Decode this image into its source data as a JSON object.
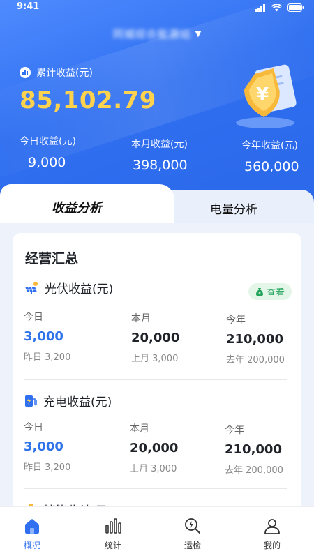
{
  "status_bar": {
    "time": "9:41"
  },
  "header": {
    "station_name": "同城综合能源站",
    "dropdown_icon": "caret-down-icon"
  },
  "summary": {
    "total_label": "累计收益(元)",
    "total_value": "85,102.79",
    "today_label": "今日收益(元)",
    "today_value": "9,000",
    "month_label": "本月收益(元)",
    "month_value": "398,000",
    "year_label": "今年收益(元)",
    "year_value": "560,000"
  },
  "tabs": [
    {
      "label": "收益分析",
      "active": true
    },
    {
      "label": "电量分析",
      "active": false
    }
  ],
  "section": {
    "title": "经营汇总",
    "view_label": "查看",
    "categories": [
      {
        "title": "光伏收益(元)",
        "icon": "solar-panel-icon",
        "columns": [
          {
            "label": "今日",
            "value": "3,000",
            "sub": "昨日 3,200"
          },
          {
            "label": "本月",
            "value": "20,000",
            "sub": "上月 3,000"
          },
          {
            "label": "今年",
            "value": "210,000",
            "sub": "去年 200,000"
          }
        ]
      },
      {
        "title": "充电收益(元)",
        "icon": "charging-pile-icon",
        "columns": [
          {
            "label": "今日",
            "value": "3,000",
            "sub": "昨日 3,200"
          },
          {
            "label": "本月",
            "value": "20,000",
            "sub": "上月 3,000"
          },
          {
            "label": "今年",
            "value": "210,000",
            "sub": "去年 200,000"
          }
        ]
      },
      {
        "title": "储能收益(元)",
        "icon": "storage-icon"
      }
    ]
  },
  "bottom_nav": [
    {
      "label": "概况",
      "icon": "home-icon",
      "active": true
    },
    {
      "label": "统计",
      "icon": "bar-chart-icon",
      "active": false
    },
    {
      "label": "运检",
      "icon": "inspect-icon",
      "active": false
    },
    {
      "label": "我的",
      "icon": "user-icon",
      "active": false
    }
  ],
  "colors": {
    "primary": "#2f6ff0",
    "gold": "#ffd34d",
    "green": "#21a35a"
  }
}
